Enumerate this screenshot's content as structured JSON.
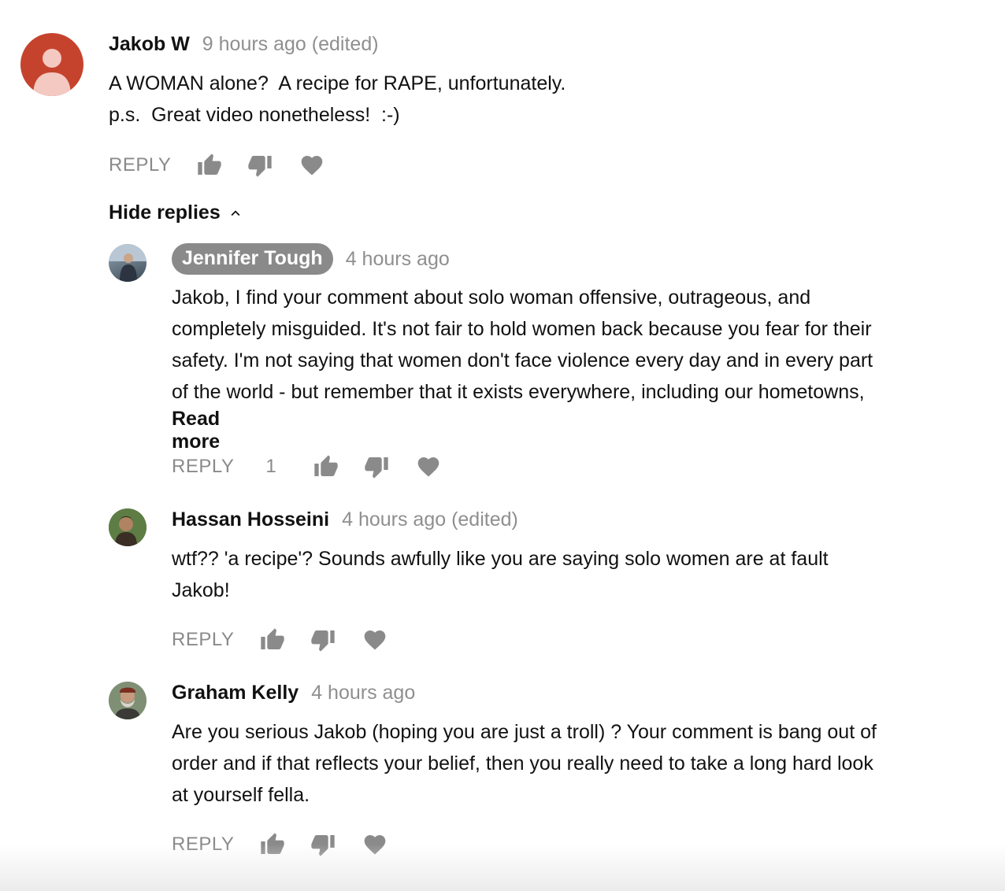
{
  "comment": {
    "author": "Jakob W",
    "time": "9 hours ago (edited)",
    "text": "A WOMAN alone?  A recipe for RAPE, unfortunately.\np.s.  Great video nonetheless!  :-)",
    "reply_label": "REPLY"
  },
  "hide_replies_label": "Hide replies",
  "replies": [
    {
      "author": "Jennifer Tough",
      "time": "4 hours ago",
      "text": "Jakob, I find your comment about solo woman offensive, outrageous, and\ncompletely misguided. It's not fair to hold women back because you fear for their\nsafety. I'm not saying that women don't face violence every day and in every part\nof the world - but remember that it exists everywhere, including our hometowns,",
      "read_more": "Read more",
      "reply_label": "REPLY",
      "like_count": "1"
    },
    {
      "author": "Hassan Hosseini",
      "time": "4 hours ago (edited)",
      "text": "wtf?? 'a recipe'? Sounds awfully like you are saying solo women are at fault\nJakob!",
      "reply_label": "REPLY"
    },
    {
      "author": "Graham Kelly",
      "time": "4 hours ago",
      "text": "Are you serious Jakob (hoping you are just a troll) ? Your comment is bang out of\norder and if that reflects your belief, then you really need to take a long hard look\nat yourself fella.",
      "reply_label": "REPLY"
    }
  ],
  "colors": {
    "meta_gray": "#8f8f8f",
    "icon_gray": "#8a8a8a",
    "default_avatar_bg": "#c5432d",
    "owner_pill_bg": "#8a8a8a"
  },
  "icons": [
    "thumbs-up-icon",
    "thumbs-down-icon",
    "heart-icon",
    "chevron-up-icon",
    "default-person-icon"
  ]
}
